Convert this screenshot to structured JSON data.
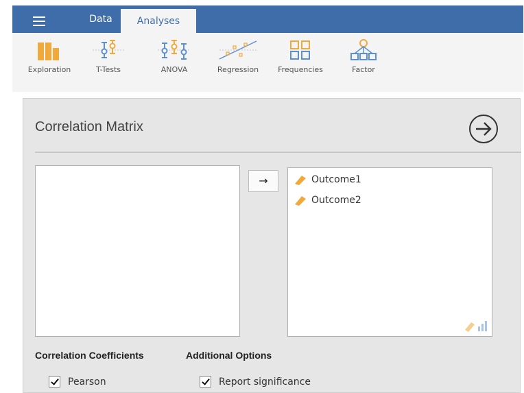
{
  "tabs": [
    {
      "label": "Data",
      "active": false
    },
    {
      "label": "Analyses",
      "active": true
    }
  ],
  "ribbon": {
    "buttons": [
      {
        "label": "Exploration",
        "icon": "exploration-icon"
      },
      {
        "label": "T-Tests",
        "icon": "t-tests-icon"
      },
      {
        "label": "ANOVA",
        "icon": "anova-icon"
      },
      {
        "label": "Regression",
        "icon": "regression-icon"
      },
      {
        "label": "Frequencies",
        "icon": "frequencies-icon"
      },
      {
        "label": "Factor",
        "icon": "factor-icon"
      }
    ]
  },
  "analysis": {
    "title": "Correlation Matrix",
    "move_arrow": "→",
    "available_variables": [],
    "selected_variables": [
      "Outcome1",
      "Outcome2"
    ]
  },
  "options": {
    "coefficients": {
      "title": "Correlation Coefficients",
      "items": [
        {
          "label": "Pearson",
          "checked": true
        }
      ]
    },
    "additional": {
      "title": "Additional Options",
      "items": [
        {
          "label": "Report significance",
          "checked": true
        }
      ]
    }
  },
  "colors": {
    "topbar": "#3e6da9",
    "icon_orange": "#f0a93b",
    "icon_blue": "#5b8fd0",
    "panel_bg": "#e6e6e6"
  }
}
